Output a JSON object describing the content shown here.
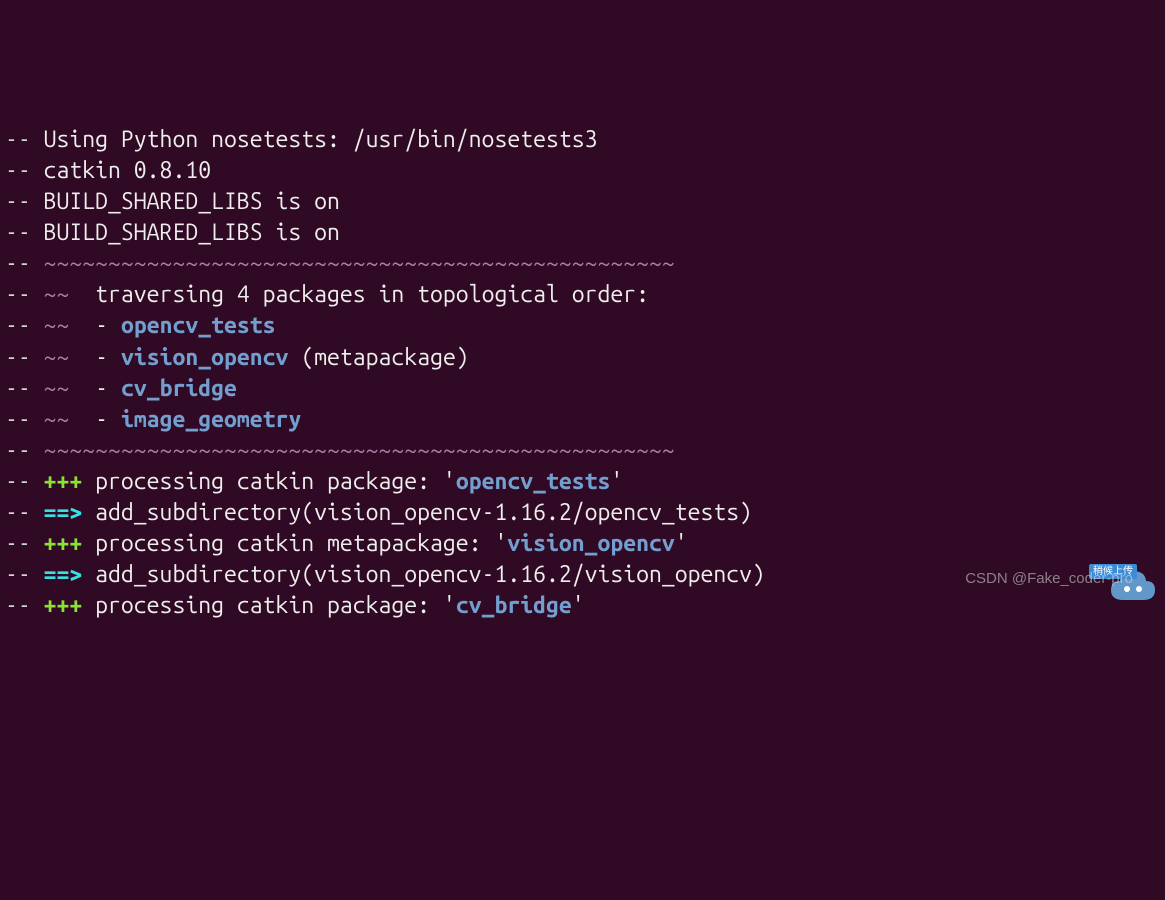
{
  "lines": [
    {
      "segments": [
        {
          "cls": "dash",
          "t": "-- "
        },
        {
          "cls": "white",
          "t": "Using Python nosetests: /usr/bin/nosetests3"
        }
      ]
    },
    {
      "segments": [
        {
          "cls": "dash",
          "t": "-- "
        },
        {
          "cls": "white",
          "t": "catkin 0.8.10"
        }
      ]
    },
    {
      "segments": [
        {
          "cls": "dash",
          "t": "-- "
        },
        {
          "cls": "white",
          "t": "BUILD_SHARED_LIBS is on"
        }
      ]
    },
    {
      "segments": [
        {
          "cls": "dash",
          "t": "-- "
        },
        {
          "cls": "white",
          "t": "BUILD_SHARED_LIBS is on"
        }
      ]
    },
    {
      "segments": [
        {
          "cls": "dash",
          "t": "-- "
        },
        {
          "cls": "magenta",
          "t": "~~~~~~~~~~~~~~~~~~~~~~~~~~~~~~~~~~~~~~~~~~~~~~~~~"
        }
      ]
    },
    {
      "segments": [
        {
          "cls": "dash",
          "t": "-- "
        },
        {
          "cls": "magenta",
          "t": "~~"
        },
        {
          "cls": "white",
          "t": "  traversing 4 packages in topological order:"
        }
      ]
    },
    {
      "segments": [
        {
          "cls": "dash",
          "t": "-- "
        },
        {
          "cls": "magenta",
          "t": "~~"
        },
        {
          "cls": "white",
          "t": "  - "
        },
        {
          "cls": "blue-bold",
          "t": "opencv_tests"
        }
      ]
    },
    {
      "segments": [
        {
          "cls": "dash",
          "t": "-- "
        },
        {
          "cls": "magenta",
          "t": "~~"
        },
        {
          "cls": "white",
          "t": "  - "
        },
        {
          "cls": "blue-bold",
          "t": "vision_opencv"
        },
        {
          "cls": "white",
          "t": " (metapackage)"
        }
      ]
    },
    {
      "segments": [
        {
          "cls": "dash",
          "t": "-- "
        },
        {
          "cls": "magenta",
          "t": "~~"
        },
        {
          "cls": "white",
          "t": "  - "
        },
        {
          "cls": "blue-bold",
          "t": "cv_bridge"
        }
      ]
    },
    {
      "segments": [
        {
          "cls": "dash",
          "t": "-- "
        },
        {
          "cls": "magenta",
          "t": "~~"
        },
        {
          "cls": "white",
          "t": "  - "
        },
        {
          "cls": "blue-bold",
          "t": "image_geometry"
        }
      ]
    },
    {
      "segments": [
        {
          "cls": "dash",
          "t": "-- "
        },
        {
          "cls": "magenta",
          "t": "~~~~~~~~~~~~~~~~~~~~~~~~~~~~~~~~~~~~~~~~~~~~~~~~~"
        }
      ]
    },
    {
      "segments": [
        {
          "cls": "dash",
          "t": "-- "
        },
        {
          "cls": "green-bold",
          "t": "+++"
        },
        {
          "cls": "white",
          "t": " processing catkin package: '"
        },
        {
          "cls": "blue-bold",
          "t": "opencv_tests"
        },
        {
          "cls": "white",
          "t": "'"
        }
      ]
    },
    {
      "segments": [
        {
          "cls": "dash",
          "t": "-- "
        },
        {
          "cls": "cyan-bold",
          "t": "==>"
        },
        {
          "cls": "white",
          "t": " add_subdirectory(vision_opencv-1.16.2/opencv_tests)"
        }
      ]
    },
    {
      "segments": [
        {
          "cls": "dash",
          "t": "-- "
        },
        {
          "cls": "green-bold",
          "t": "+++"
        },
        {
          "cls": "white",
          "t": " processing catkin metapackage: '"
        },
        {
          "cls": "blue-bold",
          "t": "vision_opencv"
        },
        {
          "cls": "white",
          "t": "'"
        }
      ]
    },
    {
      "segments": [
        {
          "cls": "dash",
          "t": "-- "
        },
        {
          "cls": "cyan-bold",
          "t": "==>"
        },
        {
          "cls": "white",
          "t": " add_subdirectory(vision_opencv-1.16.2/vision_opencv)"
        }
      ]
    },
    {
      "segments": [
        {
          "cls": "dash",
          "t": "-- "
        },
        {
          "cls": "green-bold",
          "t": "+++"
        },
        {
          "cls": "white",
          "t": " processing catkin package: '"
        },
        {
          "cls": "blue-bold",
          "t": "cv_bridge"
        },
        {
          "cls": "white",
          "t": "'"
        }
      ]
    }
  ],
  "watermark": "CSDN @Fake_coder-pro",
  "cloud_label": "稍候上传"
}
